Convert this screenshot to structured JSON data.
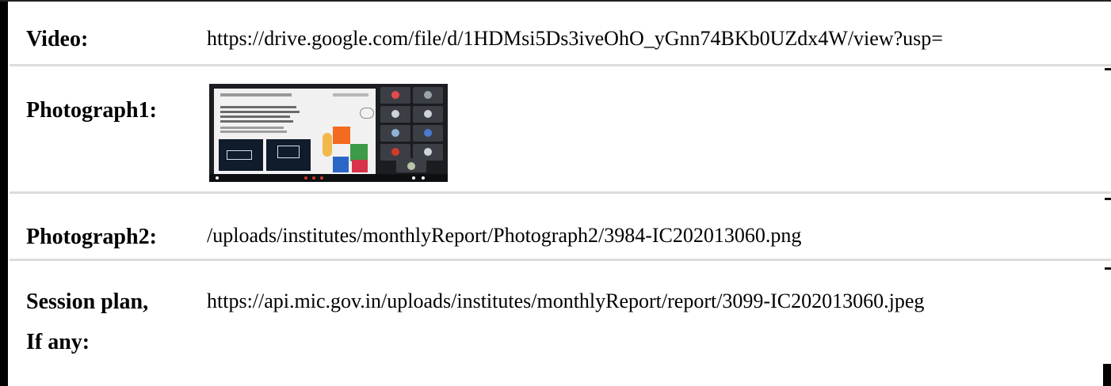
{
  "rows": {
    "video": {
      "label": "Video:",
      "value": "https://drive.google.com/file/d/1HDMsi5Ds3iveOhO_yGnn74BKb0UZdx4W/view?usp="
    },
    "photograph1": {
      "label": "Photograph1:",
      "image_icon": "meeting-screenshot-icon"
    },
    "photograph2": {
      "label": "Photograph2:",
      "value": "/uploads/institutes/monthlyReport/Photograph2/3984-IC202013060.png"
    },
    "session_plan": {
      "label_line1": "Session plan,",
      "label_line2": "If any:",
      "value": "https://api.mic.gov.in/uploads/institutes/monthlyReport/report/3099-IC202013060.jpeg"
    }
  },
  "colors": {
    "text": "#000000",
    "rule": "#dcdcdc",
    "frame": "#000000"
  }
}
